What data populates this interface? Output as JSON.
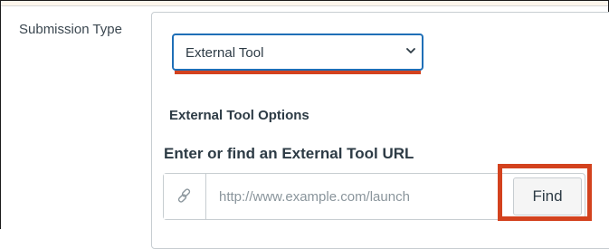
{
  "form": {
    "submission_type_label": "Submission Type",
    "submission_type_select": {
      "selected": "External Tool"
    },
    "external_tool_options_heading": "External Tool Options",
    "url_field": {
      "label": "Enter or find an External Tool URL",
      "value": "",
      "placeholder": "http://www.example.com/launch",
      "addon_icon": "link-icon"
    },
    "find_button_label": "Find"
  },
  "colors": {
    "highlight": "#d3421e",
    "select_focus_border": "#1f6fb7",
    "text": "#2d3b45",
    "border": "#c7cdd1"
  }
}
